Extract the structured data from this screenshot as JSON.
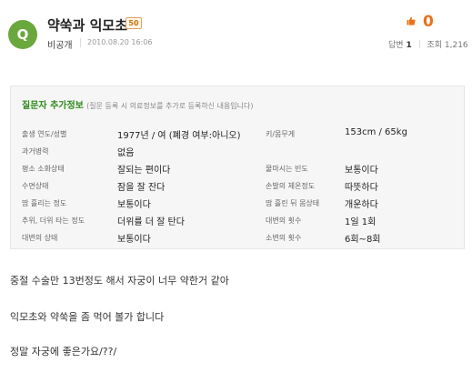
{
  "question": {
    "badge": "Q",
    "title": "약쑥과 익모초",
    "grade": "50",
    "author": "비공개",
    "date": "2010.08.20 16:06",
    "like_count": "0",
    "answers_label": "답변",
    "answers_count": "1",
    "views_label": "조회",
    "views_count": "1,216"
  },
  "info": {
    "title": "질문자 추가정보",
    "subtitle": "(질문 등록 시 의료정보를 추가로 등록하신 내용입니다)",
    "rows": [
      {
        "label_l": "출생 연도/성별",
        "value_l": "1977년 / 여 (폐경 여부:아니오)",
        "label_r": "키/몸무게",
        "value_r": "153cm / 65kg"
      },
      {
        "label_l": "과거병력",
        "value_l": "없음",
        "label_r": "",
        "value_r": ""
      },
      {
        "label_l": "평소 소화상태",
        "value_l": "잘되는 편이다",
        "label_r": "물마시는 빈도",
        "value_r": "보통이다"
      },
      {
        "label_l": "수면상태",
        "value_l": "잠을 잘 잔다",
        "label_r": "손발의 체온정도",
        "value_r": "따뜻하다"
      },
      {
        "label_l": "땀 흘리는 정도",
        "value_l": "보통이다",
        "label_r": "땀 흘린 뒤 몸상태",
        "value_r": "개운하다"
      },
      {
        "label_l": "추위, 더위 타는 정도",
        "value_l": "더위를 더 잘 탄다",
        "label_r": "대변의 횟수",
        "value_r": "1일 1회"
      },
      {
        "label_l": "대변의 상태",
        "value_l": "보통이다",
        "label_r": "소변의 횟수",
        "value_r": "6회~8회"
      }
    ]
  },
  "body": {
    "line1": "중절 수술만 13번정도 해서 자궁이 너무 약한거 같아",
    "line2": "익모초와 약쑥을 좀 먹어 볼가 합니다",
    "line3": "정말 자궁에 좋은가요/??/"
  }
}
